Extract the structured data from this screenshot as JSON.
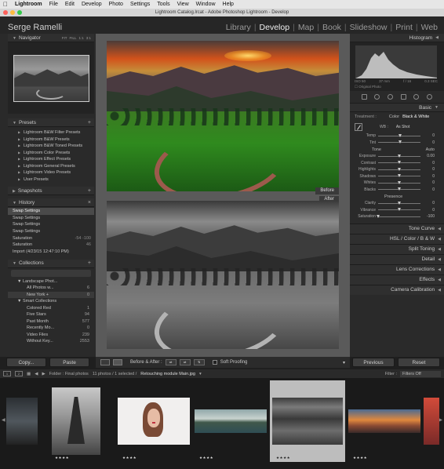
{
  "menubar": {
    "app": "Lightroom",
    "items": [
      "File",
      "Edit",
      "Develop",
      "Photo",
      "Settings",
      "Tools",
      "View",
      "Window",
      "Help"
    ]
  },
  "window": {
    "title": "Lightroom Catalog.lrcat - Adobe Photoshop Lightroom - Develop"
  },
  "identity_plate": "Serge Ramelli",
  "modules": [
    "Library",
    "Develop",
    "Map",
    "Book",
    "Slideshow",
    "Print",
    "Web"
  ],
  "left": {
    "navigator": {
      "title": "Navigator",
      "zoom": [
        "FIT",
        "FILL",
        "1:1",
        "3:1"
      ]
    },
    "presets": {
      "title": "Presets",
      "items": [
        "Lightroom B&W Filter Presets",
        "Lightroom B&W Presets",
        "Lightroom B&W Toned Presets",
        "Lightroom Color Presets",
        "Lightroom Effect Presets",
        "Lightroom General Presets",
        "Lightroom Video Presets",
        "User Presets"
      ]
    },
    "snapshots": {
      "title": "Snapshots"
    },
    "history": {
      "title": "History",
      "items": [
        {
          "label": "Swap Settings",
          "a": "",
          "b": ""
        },
        {
          "label": "Swap Settings",
          "a": "",
          "b": ""
        },
        {
          "label": "Swap Settings",
          "a": "",
          "b": ""
        },
        {
          "label": "Swap Settings",
          "a": "",
          "b": ""
        },
        {
          "label": "Saturation",
          "a": "-54",
          "b": "-100"
        },
        {
          "label": "Saturation",
          "a": "",
          "b": "46"
        },
        {
          "label": "Import (4/23/15 12:47:10 PM)",
          "a": "",
          "b": ""
        }
      ]
    },
    "collections": {
      "title": "Collections",
      "items": [
        {
          "label": "Landscape Phot...",
          "count": ""
        },
        {
          "label": "All Photos w...",
          "count": "6"
        },
        {
          "label": "New York +",
          "count": "0"
        },
        {
          "label": "Smart Collections",
          "count": ""
        },
        {
          "label": "Colored Red",
          "count": "1"
        },
        {
          "label": "Five Stars",
          "count": "94"
        },
        {
          "label": "Past Month",
          "count": "577"
        },
        {
          "label": "Recently Mo...",
          "count": "0"
        },
        {
          "label": "Video Files",
          "count": "239"
        },
        {
          "label": "Without Key...",
          "count": "2553"
        }
      ]
    },
    "buttons": {
      "copy": "Copy...",
      "paste": "Paste"
    }
  },
  "center": {
    "before_label": "Before",
    "after_label": "After",
    "toolbar": {
      "before_after": "Before & After :",
      "soft_proofing": "Soft Proofing"
    }
  },
  "right": {
    "histogram": {
      "title": "Histogram",
      "iso": "ISO 50",
      "focal": "37 mm",
      "aperture": "f / 16",
      "shutter": "0.3 SEC",
      "original": "Original Photo"
    },
    "basic": {
      "title": "Basic",
      "treatment_label": "Treatment :",
      "treatment_color": "Color",
      "treatment_bw": "Black & White",
      "wb_label": "WB :",
      "wb_value": "As Shot",
      "temp": {
        "label": "Temp",
        "value": "0"
      },
      "tint": {
        "label": "Tint",
        "value": "0"
      },
      "tone_label": "Tone",
      "auto_label": "Auto",
      "tone_sliders": [
        {
          "label": "Exposure",
          "value": "0.00",
          "pos": 0.5
        },
        {
          "label": "Contrast",
          "value": "0",
          "pos": 0.5
        },
        {
          "label": "Highlights",
          "value": "0",
          "pos": 0.5
        },
        {
          "label": "Shadows",
          "value": "0",
          "pos": 0.5
        },
        {
          "label": "Whites",
          "value": "0",
          "pos": 0.5
        },
        {
          "label": "Blacks",
          "value": "0",
          "pos": 0.5
        }
      ],
      "presence_label": "Presence",
      "presence_sliders": [
        {
          "label": "Clarity",
          "value": "0",
          "pos": 0.5
        },
        {
          "label": "Vibrance",
          "value": "0",
          "pos": 0.5
        },
        {
          "label": "Saturation",
          "value": "-100",
          "pos": 0.0
        }
      ]
    },
    "collapsed": [
      "Tone Curve",
      "HSL / Color / B & W",
      "Split Toning",
      "Detail",
      "Lens Corrections",
      "Effects",
      "Camera Calibration"
    ],
    "buttons": {
      "previous": "Previous",
      "reset": "Reset"
    }
  },
  "filmstrip": {
    "page1": "1",
    "page2": "2",
    "folder": "Folder : Final photos",
    "count": "11 photos / 1 selected /",
    "file": "Retouching module Main.jpg",
    "filter_label": "Filter :",
    "filters_value": "Filters Off",
    "stars": "★★★★"
  },
  "colors": {
    "accent": "#f0f0f0",
    "panel": "#2a2a2a",
    "background": "#1f1f1f",
    "selection": "#bdbdbd"
  }
}
